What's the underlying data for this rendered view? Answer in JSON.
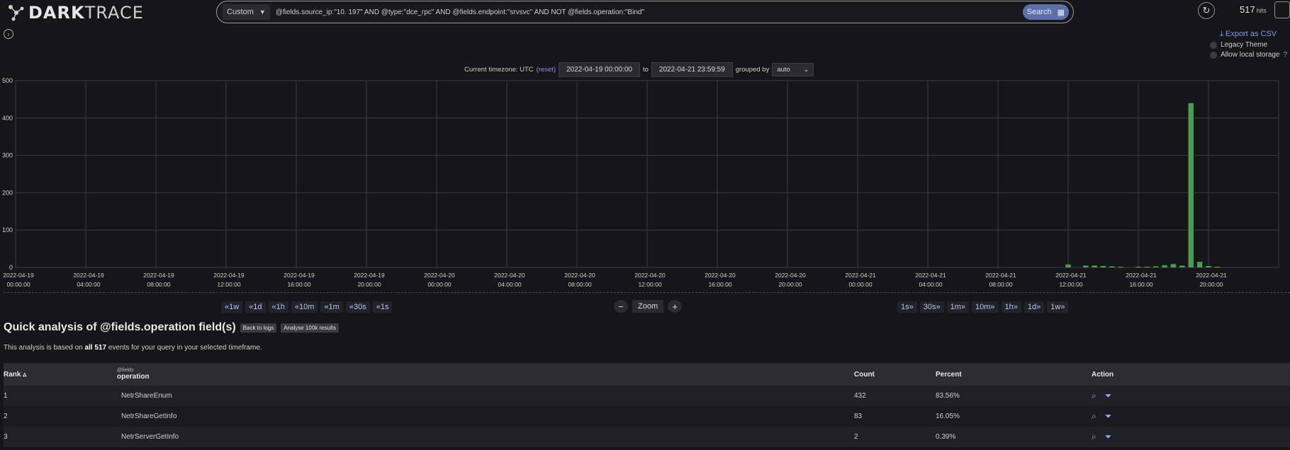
{
  "brand": {
    "bold": "DARK",
    "light": "TRACE"
  },
  "search": {
    "mode": "Custom",
    "query": "@fields.source_ip:\"10.        197\" AND @type:\"dce_rpc\" AND @fields.endpoint:\"srvsvc\" AND NOT @fields.operation:\"Bind\"",
    "button": "Search"
  },
  "hits": {
    "count": "517",
    "label": "hits"
  },
  "right_panel": {
    "export": "Export as CSV",
    "legacy": "Legacy Theme",
    "local_storage": "Allow local storage",
    "help": "?"
  },
  "timerange": {
    "prefix": "Current timezone: UTC",
    "reset": "(reset)",
    "from": "2022-04-19 00:00:00",
    "to_label": "to",
    "to": "2022-04-21 23:59:59",
    "grouped_label": "grouped by",
    "grouped_value": "auto"
  },
  "chart_data": {
    "type": "bar",
    "yticks": [
      0,
      100,
      200,
      300,
      400,
      500
    ],
    "ylim": [
      0,
      500
    ],
    "x_ticks": [
      [
        "2022-04-19",
        "00:00:00"
      ],
      [
        "2022-04-19",
        "04:00:00"
      ],
      [
        "2022-04-19",
        "08:00:00"
      ],
      [
        "2022-04-19",
        "12:00:00"
      ],
      [
        "2022-04-19",
        "16:00:00"
      ],
      [
        "2022-04-19",
        "20:00:00"
      ],
      [
        "2022-04-20",
        "00:00:00"
      ],
      [
        "2022-04-20",
        "04:00:00"
      ],
      [
        "2022-04-20",
        "08:00:00"
      ],
      [
        "2022-04-20",
        "12:00:00"
      ],
      [
        "2022-04-20",
        "16:00:00"
      ],
      [
        "2022-04-20",
        "20:00:00"
      ],
      [
        "2022-04-21",
        "00:00:00"
      ],
      [
        "2022-04-21",
        "04:00:00"
      ],
      [
        "2022-04-21",
        "08:00:00"
      ],
      [
        "2022-04-21",
        "12:00:00"
      ],
      [
        "2022-04-21",
        "16:00:00"
      ],
      [
        "2022-04-21",
        "20:00:00"
      ]
    ],
    "bars": [
      {
        "hour": 12.0,
        "value": 8
      },
      {
        "hour": 13.0,
        "value": 5
      },
      {
        "hour": 13.5,
        "value": 5
      },
      {
        "hour": 14.0,
        "value": 4
      },
      {
        "hour": 14.5,
        "value": 3
      },
      {
        "hour": 15.0,
        "value": 2
      },
      {
        "hour": 16.0,
        "value": 2
      },
      {
        "hour": 16.5,
        "value": 2
      },
      {
        "hour": 17.0,
        "value": 3
      },
      {
        "hour": 17.5,
        "value": 6
      },
      {
        "hour": 18.0,
        "value": 9
      },
      {
        "hour": 18.5,
        "value": 5
      },
      {
        "hour": 19.0,
        "value": 440
      },
      {
        "hour": 19.5,
        "value": 15
      },
      {
        "hour": 20.0,
        "value": 4
      },
      {
        "hour": 20.5,
        "value": 2
      }
    ],
    "bar_color": "#3fa34d"
  },
  "zoom": {
    "back": [
      "«1w",
      "«1d",
      "«1h",
      "«10m",
      "«1m",
      "«30s",
      "«1s"
    ],
    "label": "Zoom",
    "minus": "−",
    "plus": "+",
    "forward": [
      "1s»",
      "30s»",
      "1m»",
      "10m»",
      "1h»",
      "1d»",
      "1w»"
    ]
  },
  "analysis": {
    "title": "Quick analysis of @fields.operation field(s)",
    "back_btn": "Back to logs",
    "analyse_btn": "Analyse 100k results",
    "note_pre": "This analysis is based on",
    "note_bold": "all 517",
    "note_post": "events for your query in your selected timeframe.",
    "headers": {
      "rank": "Rank",
      "field_small": "@fields",
      "field": "operation",
      "count": "Count",
      "percent": "Percent",
      "action": "Action"
    },
    "rows": [
      {
        "rank": "1",
        "operation": "NetrShareEnum",
        "count": "432",
        "percent": "83.56%"
      },
      {
        "rank": "2",
        "operation": "NetrShareGetInfo",
        "count": "83",
        "percent": "16.05%"
      },
      {
        "rank": "3",
        "operation": "NetrServerGetInfo",
        "count": "2",
        "percent": "0.39%"
      }
    ]
  }
}
